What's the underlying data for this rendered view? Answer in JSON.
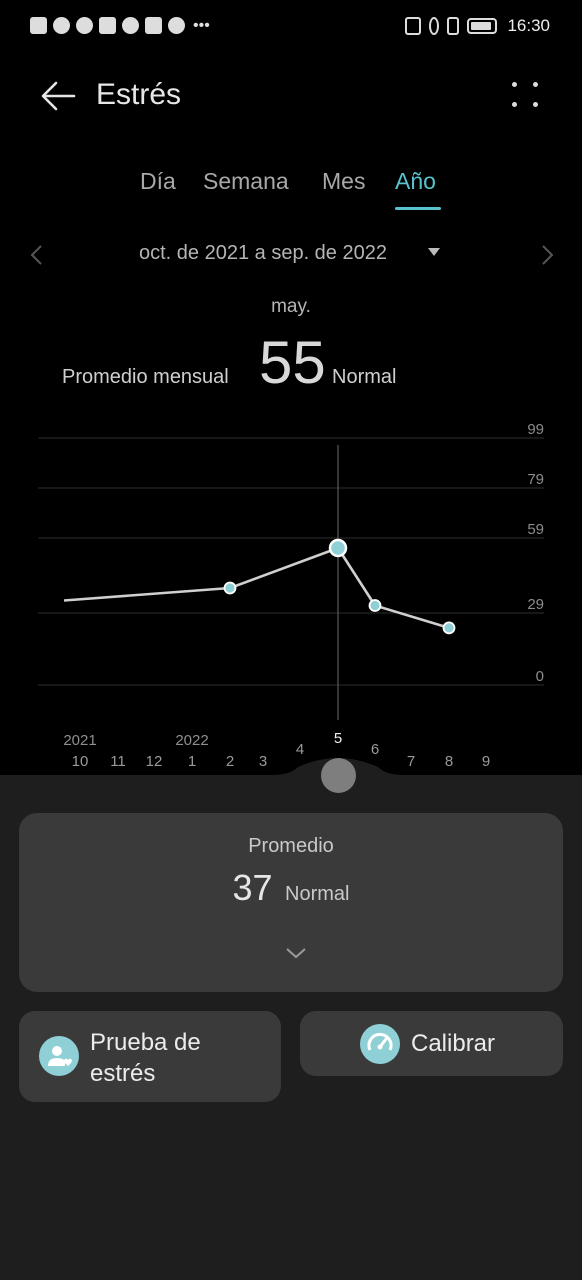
{
  "status_bar": {
    "time": "16:30",
    "left_icons": [
      "alert-icon",
      "wifi-icon",
      "health-icon",
      "app-icon",
      "cloud-icon",
      "maps-icon",
      "vpn-icon",
      "more-dots-icon"
    ],
    "right_icons": [
      "nfc-icon",
      "bluetooth-icon",
      "vibrate-icon",
      "battery-icon"
    ]
  },
  "header": {
    "title": "Estrés",
    "back_icon": "arrow-left-icon",
    "menu_icon": "more-dots-grid-icon"
  },
  "tabs": {
    "items": [
      {
        "label": "Día"
      },
      {
        "label": "Semana"
      },
      {
        "label": "Mes"
      },
      {
        "label": "Año"
      }
    ],
    "active": "Año",
    "accent": "#58c3cc"
  },
  "period": {
    "label": "oct. de 2021 a sep. de 2022"
  },
  "selection": {
    "month": "may.",
    "average_label": "Promedio mensual",
    "average_value": "55",
    "status": "Normal"
  },
  "chart_data": {
    "type": "line",
    "y_ticks": [
      "99",
      "79",
      "59",
      "29",
      "0"
    ],
    "ylim": [
      0,
      99
    ],
    "x_ticks": [
      "10",
      "11",
      "12",
      "1",
      "2",
      "3",
      "4",
      "5",
      "6",
      "7",
      "8",
      "9"
    ],
    "year_labels": [
      {
        "year": "2021",
        "at": "10"
      },
      {
        "year": "2022",
        "at": "1"
      }
    ],
    "selected_x": "5",
    "series": [
      {
        "values": [
          {
            "x": "10",
            "y": 34
          },
          {
            "x": "2",
            "y": 39
          },
          {
            "x": "5",
            "y": 55
          },
          {
            "x": "6",
            "y": 32
          },
          {
            "x": "8",
            "y": 23
          }
        ]
      }
    ],
    "line_color": "#cfcfcf",
    "point_color": "#8fd0d6"
  },
  "average_card": {
    "title": "Promedio",
    "value": "37",
    "status": "Normal",
    "expand_icon": "chevron-down-icon"
  },
  "actions": {
    "stress_test": {
      "label_line1": "Prueba de",
      "label_line2": "estrés",
      "icon": "person-heart-icon"
    },
    "calibrate": {
      "label": "Calibrar",
      "icon": "gauge-icon"
    }
  }
}
